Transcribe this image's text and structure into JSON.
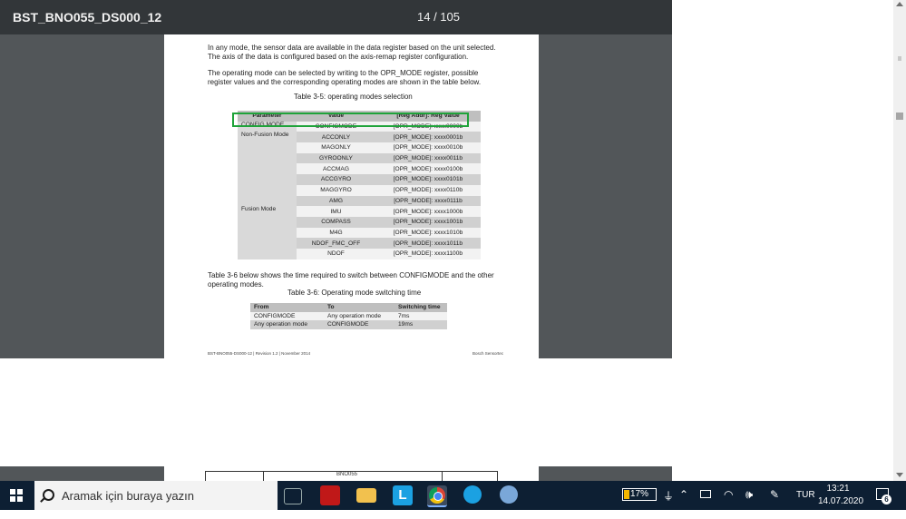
{
  "viewer": {
    "title": "BST_BNO055_DS000_12",
    "page_indicator": "14 / 105"
  },
  "page": {
    "para1": "In any mode, the sensor data are available in the data register based on the unit selected. The axis of the data is configured based on the axis-remap register configuration.",
    "para2": "The operating mode can be selected by writing to the OPR_MODE register, possible register values and the corresponding operating modes are shown in the table below.",
    "table1_caption": "Table 3-5: operating modes selection",
    "table1": {
      "headers": [
        "Parameter",
        "Value",
        "[Reg Addr]: Reg Value"
      ],
      "groups": [
        {
          "param": "CONFIG MODE",
          "rows": [
            [
              "CONFIGMODE",
              "[OPR_MODE]: xxxx0000b"
            ]
          ]
        },
        {
          "param": "Non-Fusion Mode",
          "rows": [
            [
              "ACCONLY",
              "[OPR_MODE]: xxxx0001b"
            ],
            [
              "MAGONLY",
              "[OPR_MODE]: xxxx0010b"
            ],
            [
              "GYROONLY",
              "[OPR_MODE]: xxxx0011b"
            ],
            [
              "ACCMAG",
              "[OPR_MODE]: xxxx0100b"
            ],
            [
              "ACCGYRO",
              "[OPR_MODE]: xxxx0101b"
            ],
            [
              "MAGGYRO",
              "[OPR_MODE]: xxxx0110b"
            ],
            [
              "AMG",
              "[OPR_MODE]: xxxx0111b"
            ]
          ]
        },
        {
          "param": "Fusion Mode",
          "rows": [
            [
              "IMU",
              "[OPR_MODE]: xxxx1000b"
            ],
            [
              "COMPASS",
              "[OPR_MODE]: xxxx1001b"
            ],
            [
              "M4G",
              "[OPR_MODE]: xxxx1010b"
            ],
            [
              "NDOF_FMC_OFF",
              "[OPR_MODE]: xxxx1011b"
            ],
            [
              "NDOF",
              "[OPR_MODE]: xxxx1100b"
            ]
          ]
        }
      ]
    },
    "para3": "Table 3-6 below shows the time required to switch between CONFIGMODE and the other operating modes.",
    "table2_caption": "Table 3-6: Operating mode switching time",
    "table2": {
      "headers": [
        "From",
        "To",
        "Switching time"
      ],
      "rows": [
        [
          "CONFIGMODE",
          "Any operation mode",
          "7ms"
        ],
        [
          "Any operation mode",
          "CONFIGMODE",
          "19ms"
        ]
      ]
    },
    "footer_left": "BST-BNO055-DS000-12 | Revision 1.2 | November 2014",
    "footer_right": "Bosch Sensortec",
    "next_page_text": "BNO055"
  },
  "taskbar": {
    "search_placeholder": "Aramak için buraya yazın",
    "battery_percent": "17%",
    "battery_level": 0.17,
    "language": "TUR",
    "time": "13:21",
    "date": "14.07.2020",
    "notification_count": "6",
    "apps": [
      {
        "icon": "task-view-icon",
        "color": "#0d1f33"
      },
      {
        "icon": "mcafee-icon",
        "color": "#c01818"
      },
      {
        "icon": "file-explorer-icon",
        "color": "#f2c14e"
      },
      {
        "icon": "l-app-icon",
        "color": "#1ba1e2"
      },
      {
        "icon": "chrome-icon",
        "color": "#4caf50"
      },
      {
        "icon": "whatsapp-icon",
        "color": "#25d366"
      },
      {
        "icon": "paint-icon",
        "color": "#7aa7d8"
      }
    ]
  }
}
